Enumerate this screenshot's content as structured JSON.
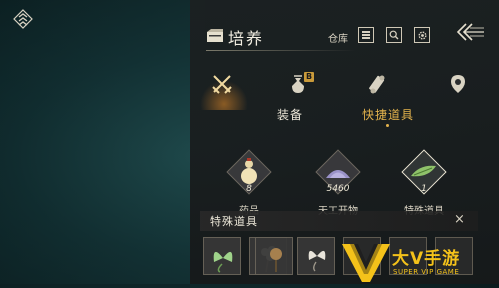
{
  "header": {
    "title": "培养",
    "warehouse_label": "仓库",
    "icons": [
      "inventory-book-icon",
      "list-icon",
      "search-icon",
      "gear-icon",
      "back-chevrons-icon"
    ]
  },
  "tabs": [
    {
      "icon": "crossed-swords-icon",
      "active": true
    },
    {
      "icon": "pouch-icon",
      "badge": "B"
    },
    {
      "icon": "scroll-icon"
    },
    {
      "icon": "location-pin-icon"
    }
  ],
  "categories": {
    "equipment": "装备",
    "quick_items": "快捷道具",
    "active": "quick_items"
  },
  "items": [
    {
      "name": "药品",
      "count": "8",
      "icon": "gourd-potion-icon"
    },
    {
      "name": "天工开物",
      "count": "5460",
      "icon": "crystal-powder-icon"
    },
    {
      "name": "特殊道具",
      "count": "1",
      "icon": "green-leaf-icon",
      "selected": true
    }
  ],
  "special_panel": {
    "title": "特殊道具",
    "close": "×"
  },
  "special_slots": [
    "green-butterfly-icon",
    "white-flower-icon",
    "brown-flower-icon",
    "white-butterfly-icon",
    "empty-slot",
    "empty-slot",
    "empty-slot"
  ],
  "watermark": {
    "text": "大V手游",
    "sub": "SUPER VIP GAME"
  },
  "colors": {
    "accent_gold": "#e3b24c",
    "watermark_yellow": "#f4c21a",
    "panel_bg": "#1c2021"
  }
}
